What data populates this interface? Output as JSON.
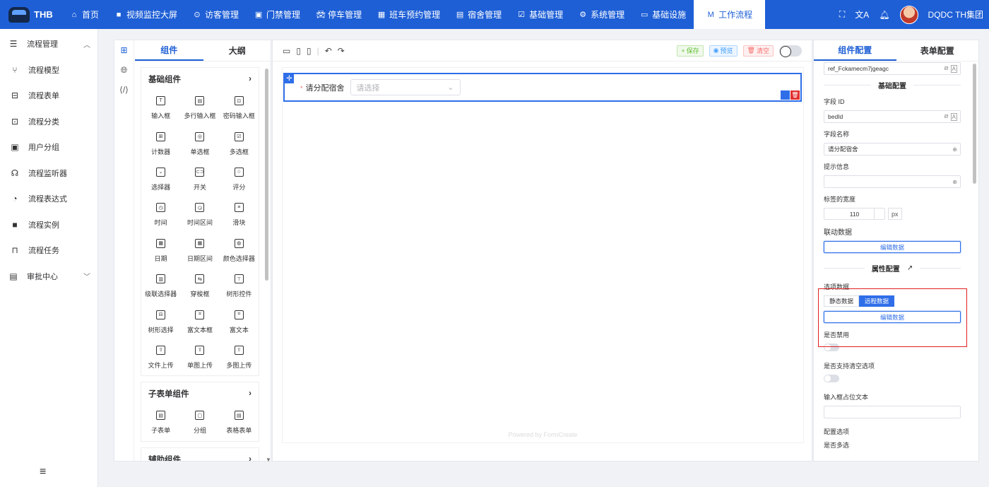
{
  "app": {
    "logo_text": "THB",
    "user_name": "DQDC TH集团"
  },
  "topnav": [
    {
      "label": "首页",
      "icon": "home-icon"
    },
    {
      "label": "视频监控大屏",
      "icon": "video-icon"
    },
    {
      "label": "访客管理",
      "icon": "location-icon"
    },
    {
      "label": "门禁管理",
      "icon": "door-icon"
    },
    {
      "label": "停车管理",
      "icon": "car-icon"
    },
    {
      "label": "班车预约管理",
      "icon": "bus-icon"
    },
    {
      "label": "宿舍管理",
      "icon": "document-icon"
    },
    {
      "label": "基础管理",
      "icon": "calendar-check-icon"
    },
    {
      "label": "系统管理",
      "icon": "gear-icon"
    },
    {
      "label": "基础设施",
      "icon": "monitor-icon"
    },
    {
      "label": "工作流程",
      "icon": "flow-logo-icon",
      "active": true
    }
  ],
  "sidebar": {
    "group1": "流程管理",
    "items": [
      "流程模型",
      "流程表单",
      "流程分类",
      "用户分组",
      "流程监听器",
      "流程表达式",
      "流程实例",
      "流程任务"
    ],
    "group2": "审批中心"
  },
  "left_panel": {
    "tabs": [
      "组件",
      "大纲"
    ],
    "groups": [
      {
        "title": "基础组件",
        "items": [
          "输入框",
          "多行输入框",
          "密码输入框",
          "计数器",
          "单选框",
          "多选框",
          "选择器",
          "开关",
          "评分",
          "时间",
          "时间区间",
          "滑块",
          "日期",
          "日期区间",
          "颜色选择器",
          "级联选择器",
          "穿梭框",
          "树形控件",
          "树形选择",
          "富文本框",
          "富文本",
          "文件上传",
          "单图上传",
          "多图上传"
        ]
      },
      {
        "title": "子表单组件",
        "items": [
          "子表单",
          "分组",
          "表格表单"
        ]
      },
      {
        "title": "辅助组件",
        "items": []
      }
    ]
  },
  "canvas": {
    "buttons": {
      "save": "保存",
      "preview": "预览",
      "clear": "清空"
    },
    "field_label": "请分配宿舍",
    "field_placeholder": "请选择",
    "powered": "Powered by FormCreate"
  },
  "right_panel": {
    "tabs": [
      "组件配置",
      "表单配置"
    ],
    "ref_value": "ref_Fckamecm7jgeagc",
    "section_basic": "基础配置",
    "field_id_label": "字段 ID",
    "field_id_value": "bedId",
    "field_name_label": "字段名称",
    "field_name_value": "请分配宿舍",
    "hint_label": "提示信息",
    "hint_value": "",
    "label_width_label": "标签的宽度",
    "label_width_value": "110",
    "label_width_unit": "px",
    "linkage_label": "联动数据",
    "edit_data": "编辑数据",
    "section_attr": "属性配置",
    "options_label": "选项数据",
    "seg_static": "静态数据",
    "seg_remote": "远程数据",
    "disabled_label": "是否禁用",
    "clearable_label": "是否支持清空选项",
    "placeholder_label": "输入框占位文本",
    "placeholder_value": "",
    "config_options_label": "配置选项",
    "more_label": "是否多选"
  }
}
